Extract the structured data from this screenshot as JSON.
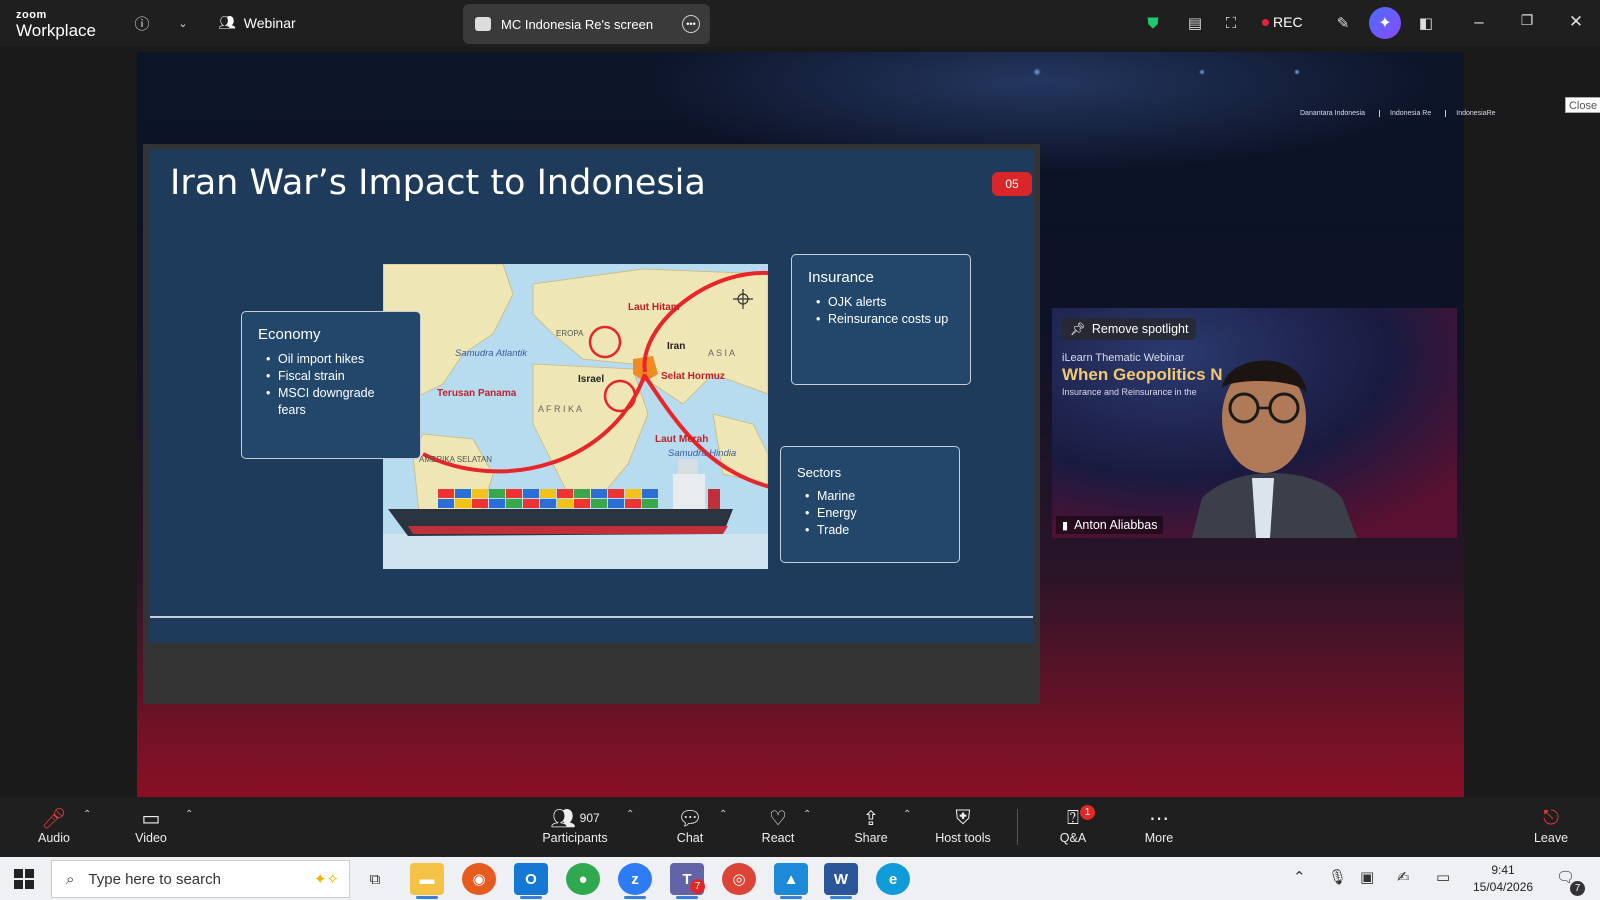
{
  "app": {
    "logo_top": "zoom",
    "logo_bottom": "Workplace"
  },
  "topbar": {
    "webinar_label": "Webinar",
    "screen_tab_label": "MC Indonesia Re's screen",
    "rec_label": "REC"
  },
  "share": {
    "close_label": "Close",
    "brands": [
      "Danantara Indonesia",
      "Indonesia Re",
      "IndonesiaRe"
    ]
  },
  "slide": {
    "title": "Iran War’s Impact to Indonesia",
    "number": "05",
    "economy": {
      "title": "Economy",
      "items": [
        "Oil import hikes",
        "Fiscal strain",
        "MSCI downgrade fears"
      ]
    },
    "insurance": {
      "title": "Insurance",
      "items": [
        "OJK alerts",
        "Reinsurance costs up"
      ]
    },
    "sectors": {
      "title": "Sectors",
      "items": [
        "Marine",
        "Energy",
        "Trade"
      ]
    },
    "map_labels": {
      "laut_hitam": "Laut Hitam",
      "eropa": "EROPA",
      "iran": "Iran",
      "asia": "A S I A",
      "samudra_atlantik": "Samudra Atlantik",
      "israel": "Israel",
      "selat_hormuz": "Selat Hormuz",
      "terusan_panama": "Terusan Panama",
      "afrika": "A F R I K A",
      "laut_merah": "Laut Merah",
      "samudra_hindia": "Samudra Hindia",
      "amerika_selatan": "AMERIKA SELATAN"
    }
  },
  "video": {
    "remove_spotlight": "Remove spotlight",
    "line1": "iLearn Thematic Webinar",
    "line2": "When Geopolitics N",
    "line3": "Insurance and Reinsurance in the",
    "speaker": "Anton Aliabbas"
  },
  "toolbar": {
    "audio": "Audio",
    "video": "Video",
    "participants": "Participants",
    "participants_count": "907",
    "chat": "Chat",
    "react": "React",
    "share": "Share",
    "host_tools": "Host tools",
    "qa": "Q&A",
    "qa_badge": "1",
    "more": "More",
    "leave": "Leave"
  },
  "taskbar": {
    "search_placeholder": "Type here to search",
    "time": "9:41",
    "date": "15/04/2026",
    "teams_badge": "7",
    "notif_badge": "7"
  },
  "colors": {
    "accent_red": "#d8262a",
    "slide_bg": "#1e3b5c",
    "toolbar_bg": "#1f1f1f"
  }
}
